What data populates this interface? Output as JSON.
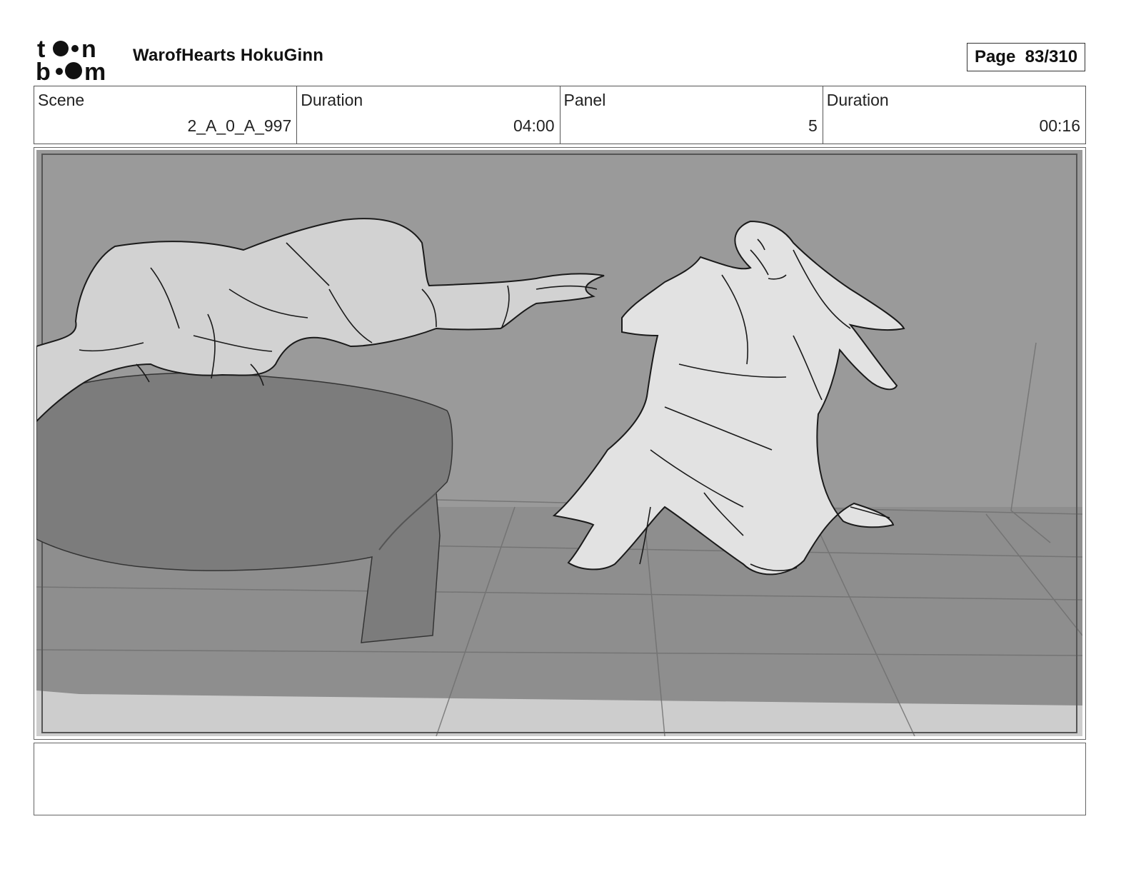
{
  "header": {
    "logo_text_top": "toon",
    "logo_text_bottom": "boom",
    "project_title": "WarofHearts HokuGinn",
    "page_label": "Page  83/310"
  },
  "info": [
    {
      "label": "Scene",
      "value": "2_A_0_A_997"
    },
    {
      "label": "Duration",
      "value": "04:00"
    },
    {
      "label": "Panel",
      "value": "5"
    },
    {
      "label": "Duration",
      "value": "00:16"
    }
  ],
  "panel": {
    "image": "storyboard-sketch",
    "colors": {
      "wall": "#9a9a9a",
      "floor": "#8c8c8c",
      "bed": "#7c7c7c",
      "figure": "#d2d2d2",
      "figure_light": "#e4e4e4",
      "foreground_strip": "#cfcfcf",
      "line": "#1a1a1a"
    }
  },
  "notes": {
    "text": ""
  }
}
